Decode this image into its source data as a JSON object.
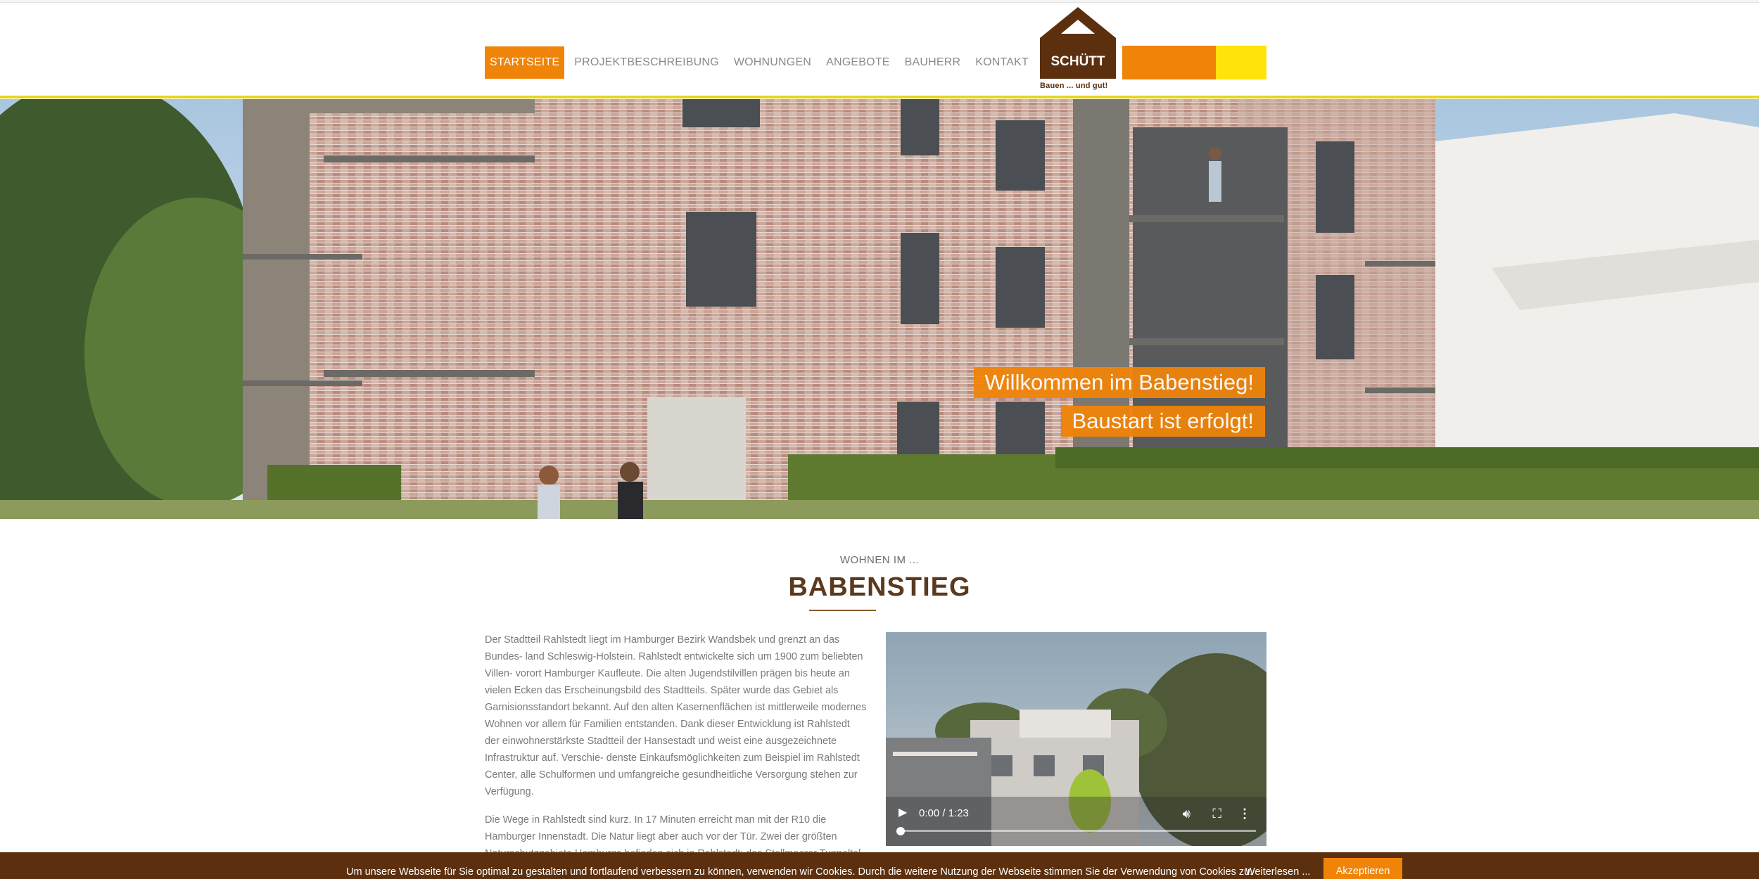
{
  "nav": {
    "items": [
      {
        "label": "STARTSEITE",
        "active": true
      },
      {
        "label": "PROJEKTBESCHREIBUNG",
        "active": false
      },
      {
        "label": "WOHNUNGEN",
        "active": false
      },
      {
        "label": "ANGEBOTE",
        "active": false
      },
      {
        "label": "BAUHERR",
        "active": false
      },
      {
        "label": "KONTAKT",
        "active": false
      }
    ]
  },
  "logo": {
    "name": "SCHÜTT",
    "slogan": "Bauen ... und gut!"
  },
  "brand_colors": {
    "orange": "#ef8409",
    "yellow": "#ffe30a",
    "brown": "#5c300f"
  },
  "hero": {
    "line1": "Willkommen im Babenstieg!",
    "line2": "Baustart ist erfolgt!"
  },
  "intro": {
    "kicker": "WOHNEN IM ...",
    "title": "BABENSTIEG"
  },
  "body": {
    "paragraph1": "Der Stadtteil Rahlstedt liegt im Hamburger Bezirk Wandsbek und grenzt an das Bundes- land Schleswig-Holstein. Rahlstedt entwickelte sich um 1900 zum beliebten Villen- vorort Hamburger Kaufleute. Die alten Jugendstilvillen prägen bis heute an vielen Ecken das Erscheinungsbild des Stadtteils. Später wurde das Gebiet als Garnisionsstandort bekannt. Auf den alten Kasernenflächen ist mittlerweile modernes Wohnen vor allem für Familien entstanden. Dank dieser Entwicklung ist Rahlstedt der einwohnerstärkste Stadtteil der Hansestadt und weist eine ausgezeichnete Infrastruktur auf. Verschie- denste Einkaufsmöglichkeiten zum Beispiel im Rahlstedt Center, alle Schulformen und umfangreiche gesundheitliche Versorgung stehen zur Verfügung.",
    "paragraph2": "Die Wege in Rahlstedt sind kurz. In 17 Minuten erreicht man mit der R10 die Hamburger Innenstadt. Die Natur liegt aber auch vor der Tür. Zwei der größten Naturschutzgebiete Hamburgs befinden sich in Rahlstedt: das Stellmoorer Tunneltal und der Höltigbaum."
  },
  "video": {
    "time": "0:00 / 1:23",
    "progress": 0
  },
  "cookie": {
    "text": "Um unsere Webseite für Sie optimal zu gestalten und fortlaufend verbessern zu können, verwenden wir Cookies. Durch die weitere Nutzung der Webseite stimmen Sie der Verwendung von Cookies zu.",
    "more_label": "Weiterlesen ...",
    "accept_label": "Akzeptieren"
  }
}
